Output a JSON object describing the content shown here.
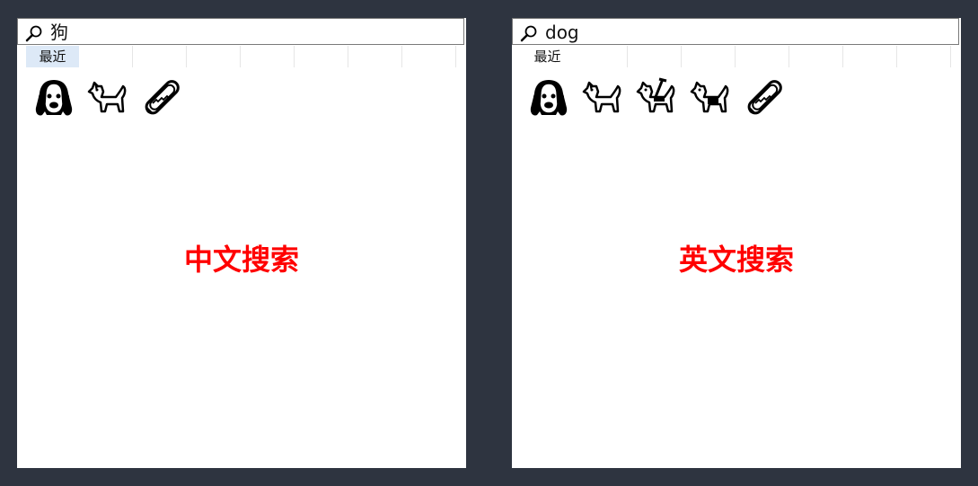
{
  "panels": [
    {
      "query": "狗",
      "tab_label": "最近",
      "tab_selected": true,
      "caption": "中文搜索",
      "caption_color": "#ff0000",
      "results": [
        "dog-face-icon",
        "dog-icon",
        "hot-dog-icon"
      ]
    },
    {
      "query": "dog",
      "tab_label": "最近",
      "tab_selected": false,
      "caption": "英文搜索",
      "caption_color": "#ff0000",
      "results": [
        "dog-face-icon",
        "dog-icon",
        "guide-dog-icon",
        "service-dog-icon",
        "hot-dog-icon"
      ]
    }
  ],
  "colors": {
    "background": "#2e3440",
    "tab_selected": "#dde9f7",
    "caption": "#ff0000"
  }
}
